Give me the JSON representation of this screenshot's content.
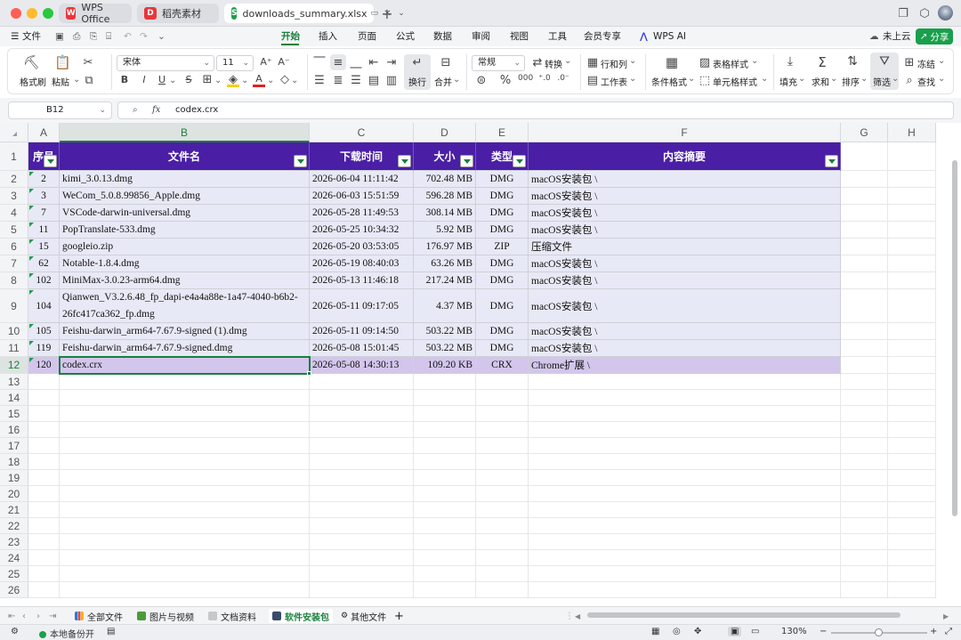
{
  "window": {
    "tabs": [
      {
        "label": "WPS Office",
        "logo": "W",
        "logo_color": "#e8373a"
      },
      {
        "label": "稻壳素材",
        "logo": "D",
        "logo_color": "#e8373a"
      },
      {
        "label": "downloads_summary.xlsx",
        "logo": "S",
        "logo_color": "#1a9f4c"
      }
    ]
  },
  "menu": {
    "file": "文件",
    "items": [
      "开始",
      "插入",
      "页面",
      "公式",
      "数据",
      "审阅",
      "视图",
      "工具",
      "会员专享",
      "WPS AI"
    ],
    "active": "开始",
    "cloud": "未上云",
    "share": "分享"
  },
  "ribbon": {
    "format_painter": "格式刷",
    "paste": "粘贴",
    "font_name": "宋体",
    "font_size": "11",
    "bold": "B",
    "italic": "I",
    "underline": "U",
    "strike": "S",
    "wrap": "换行",
    "merge": "合并",
    "number_format": "常规",
    "convert": "转换",
    "rows_cols": "行和列",
    "worksheet": "工作表",
    "cond_format": "条件格式",
    "table_style": "表格样式",
    "cell_style": "单元格样式",
    "fill": "填充",
    "sum": "求和",
    "sort": "排序",
    "filter": "筛选",
    "freeze": "冻结",
    "find": "查找"
  },
  "formula_bar": {
    "cell_ref": "B12",
    "fx": "fx",
    "content": "codex.crx"
  },
  "columns": [
    "A",
    "B",
    "C",
    "D",
    "E",
    "F",
    "G",
    "H"
  ],
  "row_numbers": [
    "1",
    "2",
    "3",
    "4",
    "5",
    "6",
    "7",
    "8",
    "9",
    "10",
    "11",
    "12",
    "13",
    "14",
    "15",
    "16",
    "17",
    "18",
    "19",
    "20",
    "21",
    "22",
    "23",
    "24",
    "25",
    "26"
  ],
  "table": {
    "headers": [
      "序号",
      "文件名",
      "下载时间",
      "大小",
      "类型",
      "内容摘要"
    ],
    "rows": [
      {
        "seq": "2",
        "name": "kimi_3.0.13.dmg",
        "time": "2026-06-04 11:11:42",
        "size": "702.48 MB",
        "type": "DMG",
        "summary": "macOS安装包 \\"
      },
      {
        "seq": "3",
        "name": "WeCom_5.0.8.99856_Apple.dmg",
        "time": "2026-06-03 15:51:59",
        "size": "596.28 MB",
        "type": "DMG",
        "summary": "macOS安装包 \\"
      },
      {
        "seq": "7",
        "name": "VSCode-darwin-universal.dmg",
        "time": "2026-05-28 11:49:53",
        "size": "308.14 MB",
        "type": "DMG",
        "summary": "macOS安装包 \\"
      },
      {
        "seq": "11",
        "name": "PopTranslate-533.dmg",
        "time": "2026-05-25 10:34:32",
        "size": "5.92 MB",
        "type": "DMG",
        "summary": "macOS安装包 \\"
      },
      {
        "seq": "15",
        "name": "googleio.zip",
        "time": "2026-05-20 03:53:05",
        "size": "176.97 MB",
        "type": "ZIP",
        "summary": "压缩文件"
      },
      {
        "seq": "62",
        "name": "Notable-1.8.4.dmg",
        "time": "2026-05-19 08:40:03",
        "size": "63.26 MB",
        "type": "DMG",
        "summary": "macOS安装包 \\"
      },
      {
        "seq": "102",
        "name": "MiniMax-3.0.23-arm64.dmg",
        "time": "2026-05-13 11:46:18",
        "size": "217.24 MB",
        "type": "DMG",
        "summary": "macOS安装包 \\"
      },
      {
        "seq": "104",
        "name": "Qianwen_V3.2.6.48_fp_dapi-e4a4a88e-1a47-4040-b6b2-26fc417ca362_fp.dmg",
        "time": "2026-05-11 09:17:05",
        "size": "4.37 MB",
        "type": "DMG",
        "summary": "macOS安装包 \\"
      },
      {
        "seq": "105",
        "name": "Feishu-darwin_arm64-7.67.9-signed (1).dmg",
        "time": "2026-05-11 09:14:50",
        "size": "503.22 MB",
        "type": "DMG",
        "summary": "macOS安装包 \\"
      },
      {
        "seq": "119",
        "name": "Feishu-darwin_arm64-7.67.9-signed.dmg",
        "time": "2026-05-08 15:01:45",
        "size": "503.22 MB",
        "type": "DMG",
        "summary": "macOS安装包 \\"
      },
      {
        "seq": "120",
        "name": "codex.crx",
        "time": "2026-05-08 14:30:13",
        "size": "109.20 KB",
        "type": "CRX",
        "summary": "Chrome扩展 \\"
      }
    ]
  },
  "sheets": [
    "全部文件",
    "图片与视频",
    "文档资料",
    "软件安装包",
    "其他文件"
  ],
  "active_sheet": "软件安装包",
  "status": {
    "backup": "本地备份开",
    "zoom": "130%"
  }
}
